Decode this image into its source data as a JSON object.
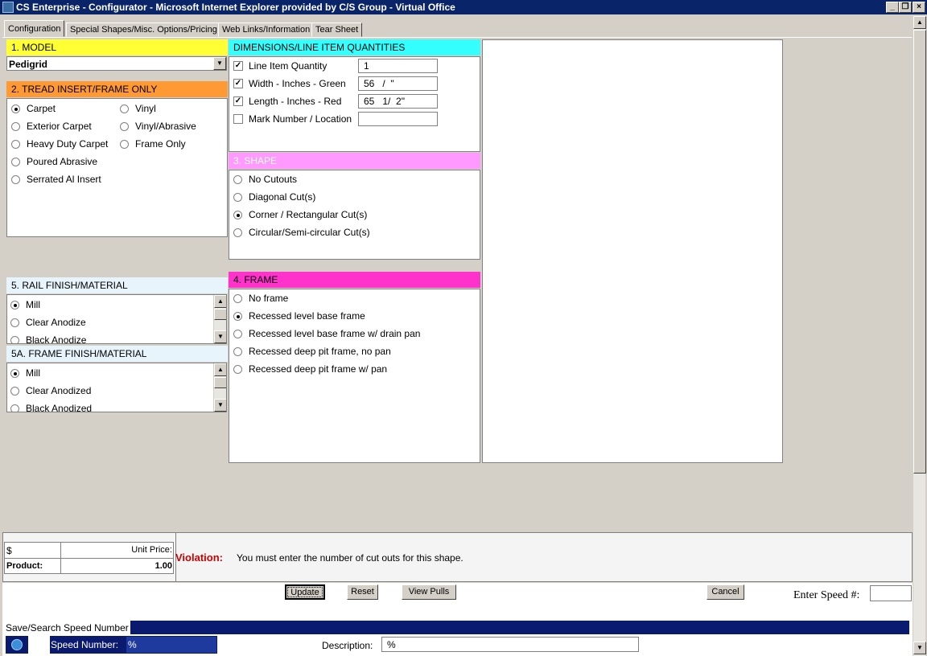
{
  "window": {
    "title": "CS Enterprise - Configurator - Microsoft Internet Explorer provided by C/S Group - Virtual Office"
  },
  "tabs": [
    "Configuration",
    "Special Shapes/Misc. Options/Pricing",
    "Web Links/Information",
    "Tear Sheet"
  ],
  "model": {
    "header": "1. MODEL",
    "selected": "Pedigrid"
  },
  "tread": {
    "header": "2. TREAD INSERT/FRAME ONLY",
    "options_left": [
      "Carpet",
      "Exterior Carpet",
      "Heavy Duty Carpet",
      "Poured Abrasive",
      "Serrated Al Insert"
    ],
    "options_right": [
      "Vinyl",
      "Vinyl/Abrasive",
      "Frame Only"
    ]
  },
  "dimensions": {
    "header": "DIMENSIONS/LINE ITEM QUANTITIES",
    "rows": [
      {
        "label": "Line Item Quantity",
        "value": "1"
      },
      {
        "label": "Width - Inches - Green",
        "value": "56   /  \""
      },
      {
        "label": "Length - Inches - Red",
        "value": "65   1/  2\""
      },
      {
        "label": "Mark Number / Location",
        "value": ""
      }
    ]
  },
  "shape": {
    "header": "3. SHAPE",
    "options": [
      "No Cutouts",
      "Diagonal Cut(s)",
      "Corner / Rectangular Cut(s)",
      "Circular/Semi-circular Cut(s)"
    ]
  },
  "frame": {
    "header": "4. FRAME",
    "options": [
      "No frame",
      "Recessed level base frame",
      "Recessed level base frame w/ drain pan",
      "Recessed deep pit frame, no pan",
      "Recessed deep pit frame w/ pan"
    ]
  },
  "rail": {
    "header": "5. RAIL FINISH/MATERIAL",
    "options": [
      "Mill",
      "Clear Anodize",
      "Black Anodize"
    ]
  },
  "frame_finish": {
    "header": "5A. FRAME FINISH/MATERIAL",
    "options": [
      "Mill",
      "Clear Anodized",
      "Black Anodized"
    ]
  },
  "pricing": {
    "currency": "$",
    "unit_price_label": "Unit Price:",
    "product_label": "Product:",
    "product_value": "1.00"
  },
  "violation": {
    "label": "Violation:",
    "message": "You must enter the number of cut outs for this shape."
  },
  "buttons": {
    "update": "Update",
    "reset": "Reset",
    "view_pulls": "View Pulls",
    "cancel": "Cancel"
  },
  "speed": {
    "label": "Enter Speed #:",
    "value": ""
  },
  "search": {
    "header": "Save/Search Speed Number",
    "speed_label": "Speed Number:",
    "speed_value": "%",
    "desc_label": "Description:",
    "desc_value": "%"
  },
  "colors": {
    "model": "#ffff33",
    "tread": "#ff9933",
    "dimensions": "#33ffff",
    "shape": "#ff99ff",
    "frame": "#ff33cc",
    "finish": "#e8f4fb",
    "titlebar": "#0a246a"
  }
}
